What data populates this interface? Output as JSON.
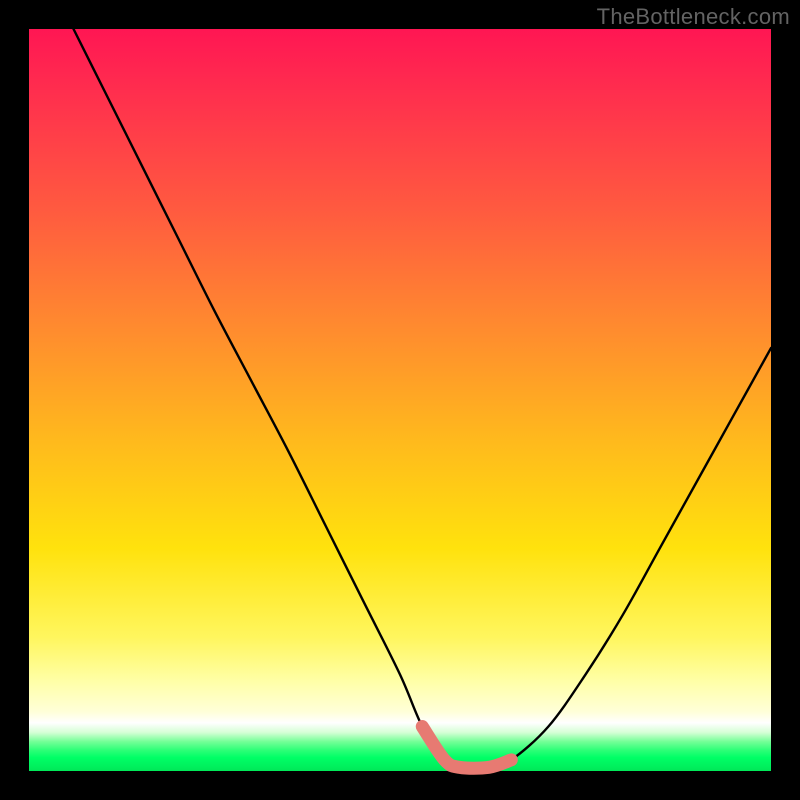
{
  "watermark": "TheBottleneck.com",
  "colors": {
    "page_bg": "#000000",
    "watermark_text": "#636363",
    "curve_stroke": "#000000",
    "trough_highlight": "#e77a72"
  },
  "chart_data": {
    "type": "line",
    "title": "",
    "xlabel": "",
    "ylabel": "",
    "xlim": [
      0,
      100
    ],
    "ylim": [
      0,
      100
    ],
    "annotations": [
      "TheBottleneck.com"
    ],
    "series": [
      {
        "name": "bottleneck-curve",
        "x": [
          6,
          10,
          15,
          20,
          25,
          30,
          35,
          40,
          45,
          50,
          53,
          56,
          58,
          62,
          65,
          70,
          75,
          80,
          85,
          90,
          95,
          100
        ],
        "y": [
          100,
          92,
          82,
          72,
          62,
          52.5,
          43,
          33,
          23,
          13,
          6,
          1.5,
          0.5,
          0.5,
          1.5,
          6,
          13,
          21,
          30,
          39,
          48,
          57
        ]
      },
      {
        "name": "trough-highlight",
        "x": [
          53,
          56,
          58,
          62,
          65
        ],
        "y": [
          6,
          1.5,
          0.5,
          0.5,
          1.5
        ]
      }
    ]
  }
}
